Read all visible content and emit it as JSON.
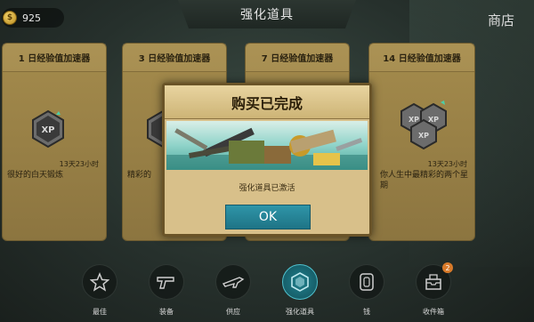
{
  "top_bar": {
    "coin_balance": "925",
    "coin_icon": "coin-icon",
    "title": "强化道具",
    "shop_label": "商店"
  },
  "cards": [
    {
      "title": "1 日经验值加速器",
      "timer": "",
      "description": "很好的白天锻炼",
      "icon": "xp-icon"
    },
    {
      "title": "3 日经验值加速器",
      "timer": "",
      "description": "精彩的",
      "icon": "xp-icon"
    },
    {
      "title": "7 日经验值加速器",
      "timer": "",
      "description": "",
      "icon": "xp-icon"
    },
    {
      "title": "14 日经验值加速器",
      "timer": "13天23小时",
      "description": "你人生中最精彩的两个星期",
      "icon": "xp-stack-icon"
    }
  ],
  "first_card_timer": "13天23小时",
  "modal": {
    "title": "购买已完成",
    "message": "强化道具已激活",
    "ok_label": "OK"
  },
  "bottom_nav": [
    {
      "label": "最佳",
      "icon": "star-icon",
      "active": false
    },
    {
      "label": "装备",
      "icon": "pistol-icon",
      "active": false
    },
    {
      "label": "供应",
      "icon": "rifle-icon",
      "active": false
    },
    {
      "label": "强化道具",
      "icon": "boost-icon",
      "active": true
    },
    {
      "label": "钱",
      "icon": "money-icon",
      "active": false
    },
    {
      "label": "收件箱",
      "icon": "inbox-icon",
      "active": false,
      "badge": "2"
    }
  ],
  "colors": {
    "card_bg": "#a48b4c",
    "accent": "#1e7486",
    "modal_bg": "#d8c08a"
  }
}
